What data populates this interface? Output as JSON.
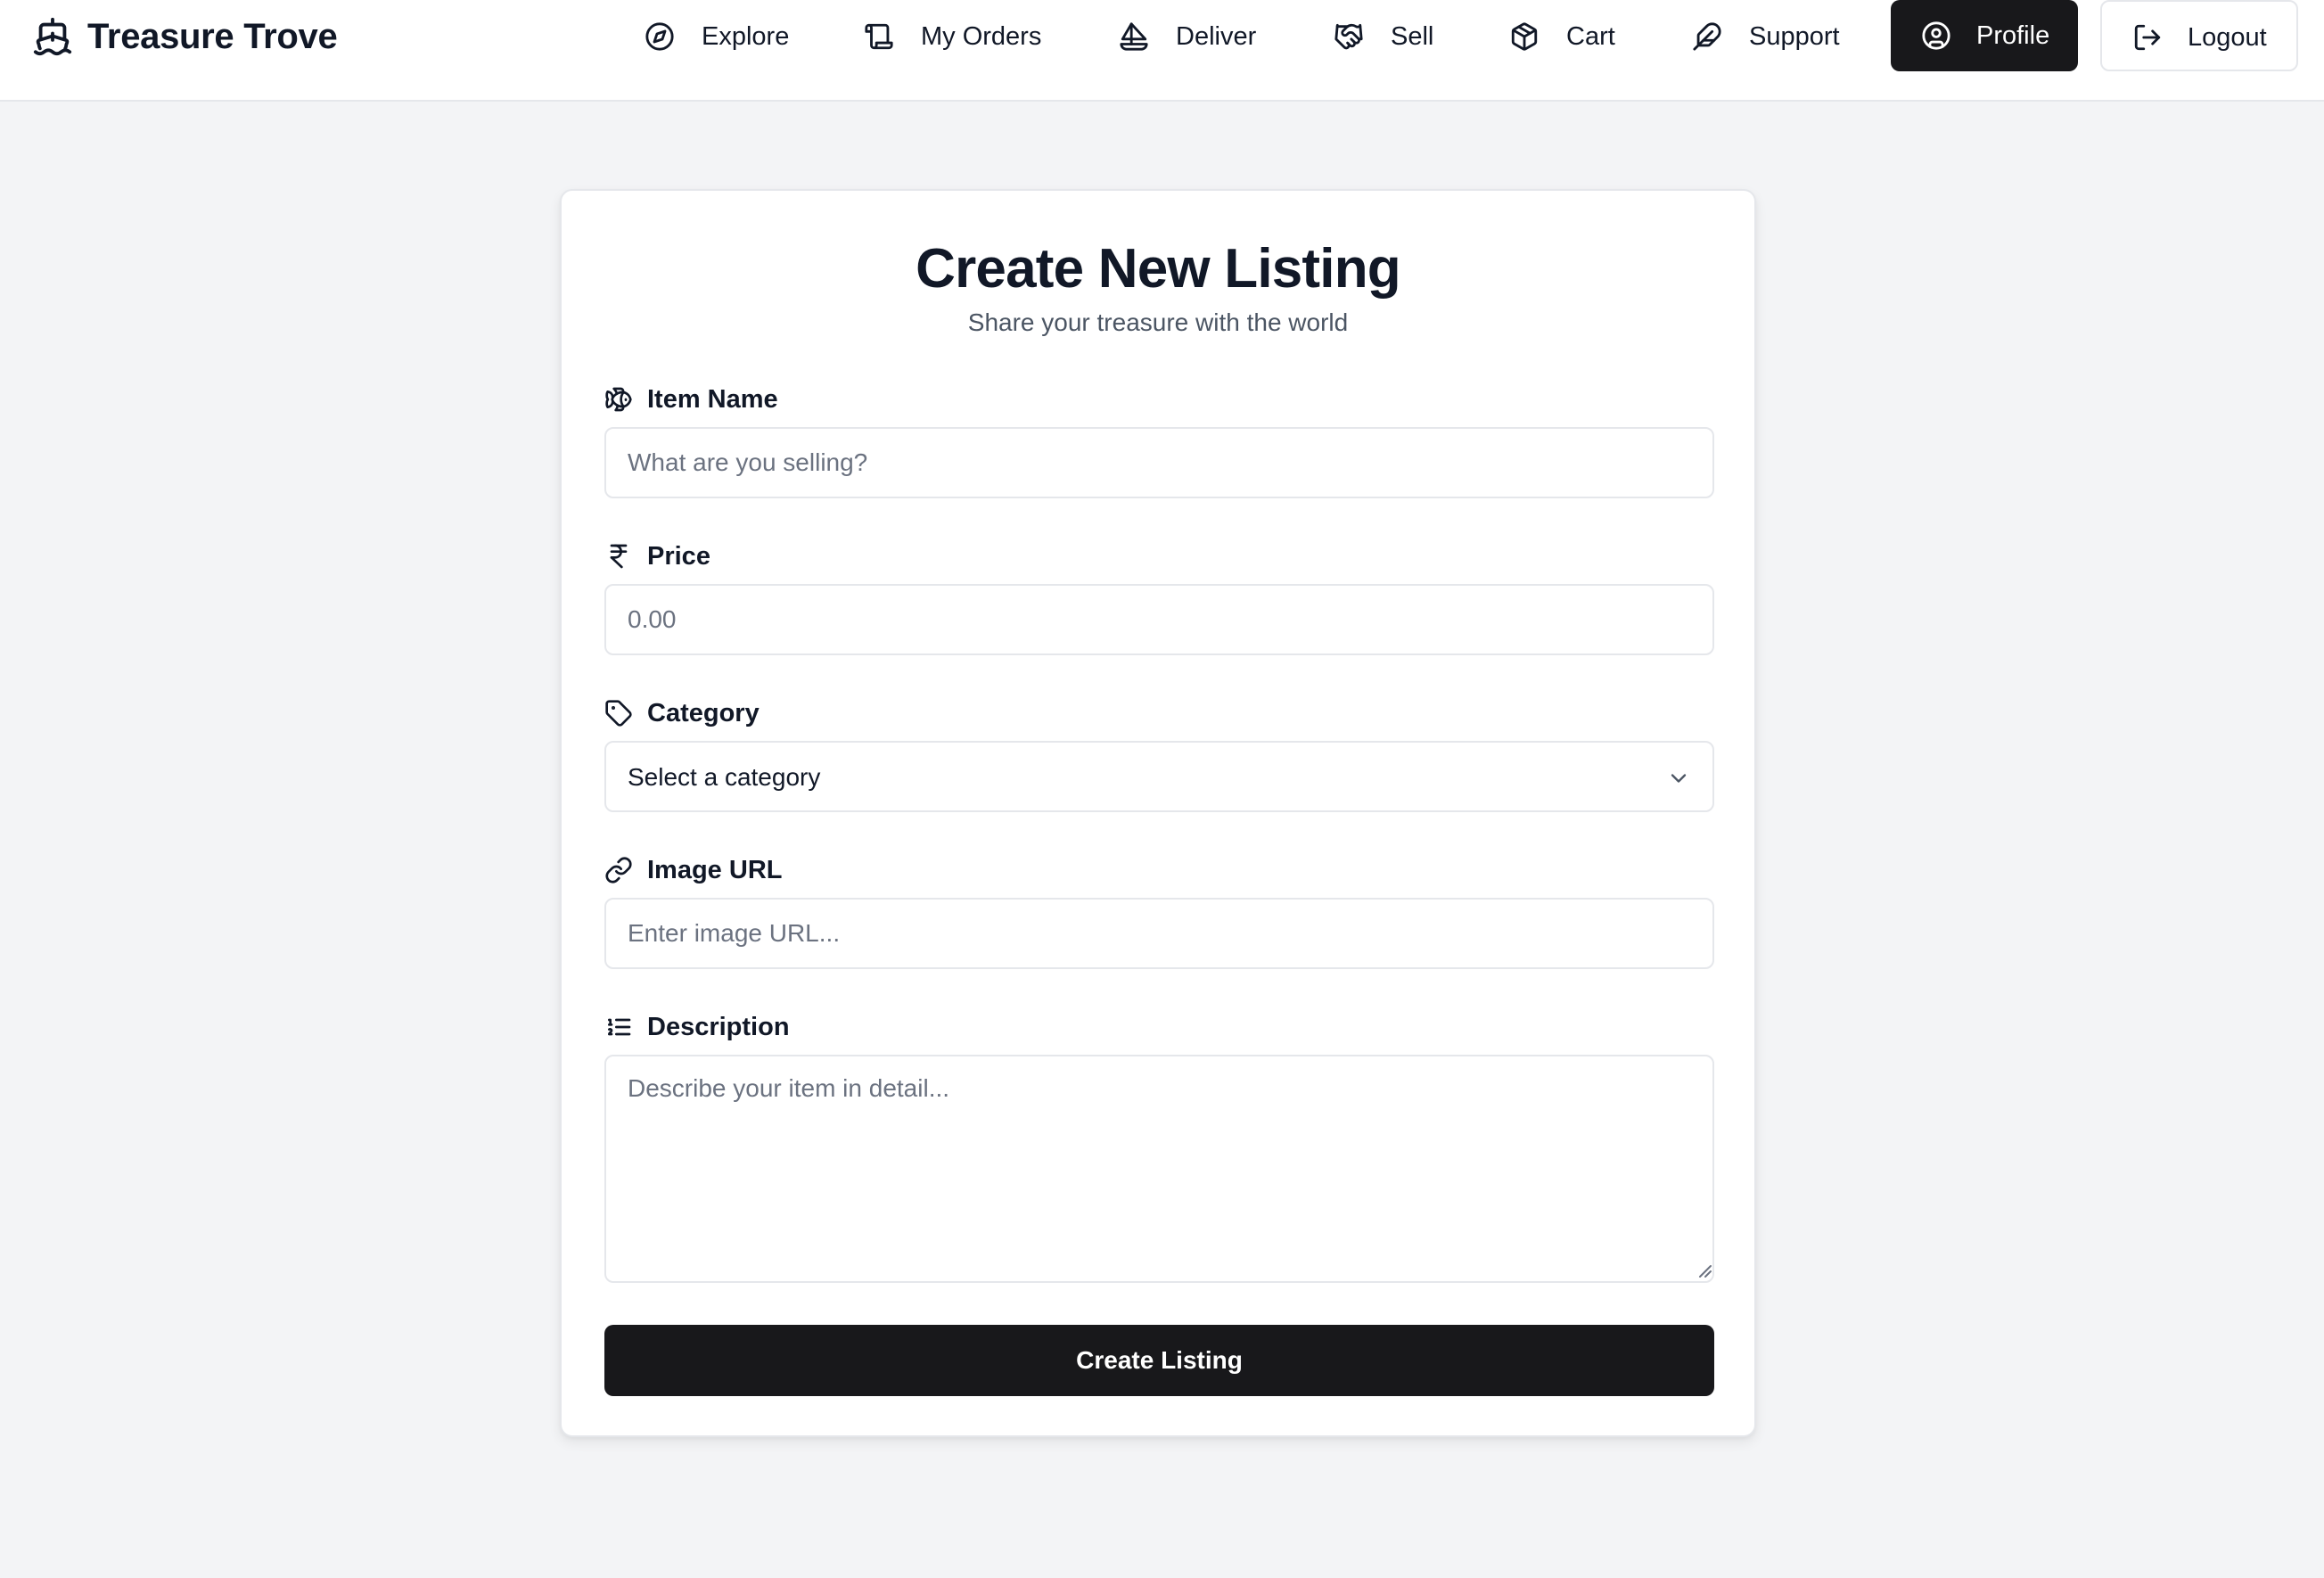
{
  "brand": {
    "name": "Treasure Trove",
    "icon": "ship-icon"
  },
  "nav": {
    "items": [
      {
        "label": "Explore",
        "icon": "compass-icon"
      },
      {
        "label": "My Orders",
        "icon": "scroll-icon"
      },
      {
        "label": "Deliver",
        "icon": "sailboat-icon"
      },
      {
        "label": "Sell",
        "icon": "handshake-icon"
      },
      {
        "label": "Cart",
        "icon": "package-icon"
      },
      {
        "label": "Support",
        "icon": "feather-icon"
      }
    ],
    "profile_label": "Profile",
    "logout_label": "Logout"
  },
  "form": {
    "title": "Create New Listing",
    "subtitle": "Share your treasure with the world",
    "fields": {
      "item_name": {
        "label": "Item Name",
        "placeholder": "What are you selling?",
        "icon": "fish-icon"
      },
      "price": {
        "label": "Price",
        "placeholder": "0.00",
        "icon": "rupee-icon"
      },
      "category": {
        "label": "Category",
        "value": "Select a category",
        "icon": "tag-icon"
      },
      "image_url": {
        "label": "Image URL",
        "placeholder": "Enter image URL...",
        "icon": "link-icon"
      },
      "description": {
        "label": "Description",
        "placeholder": "Describe your item in detail...",
        "icon": "list-icon"
      }
    },
    "submit_label": "Create Listing"
  },
  "colors": {
    "background": "#f3f4f6",
    "surface": "#ffffff",
    "border": "#e5e7eb",
    "primary": "#18181b",
    "text": "#111827",
    "muted": "#6b7280"
  }
}
